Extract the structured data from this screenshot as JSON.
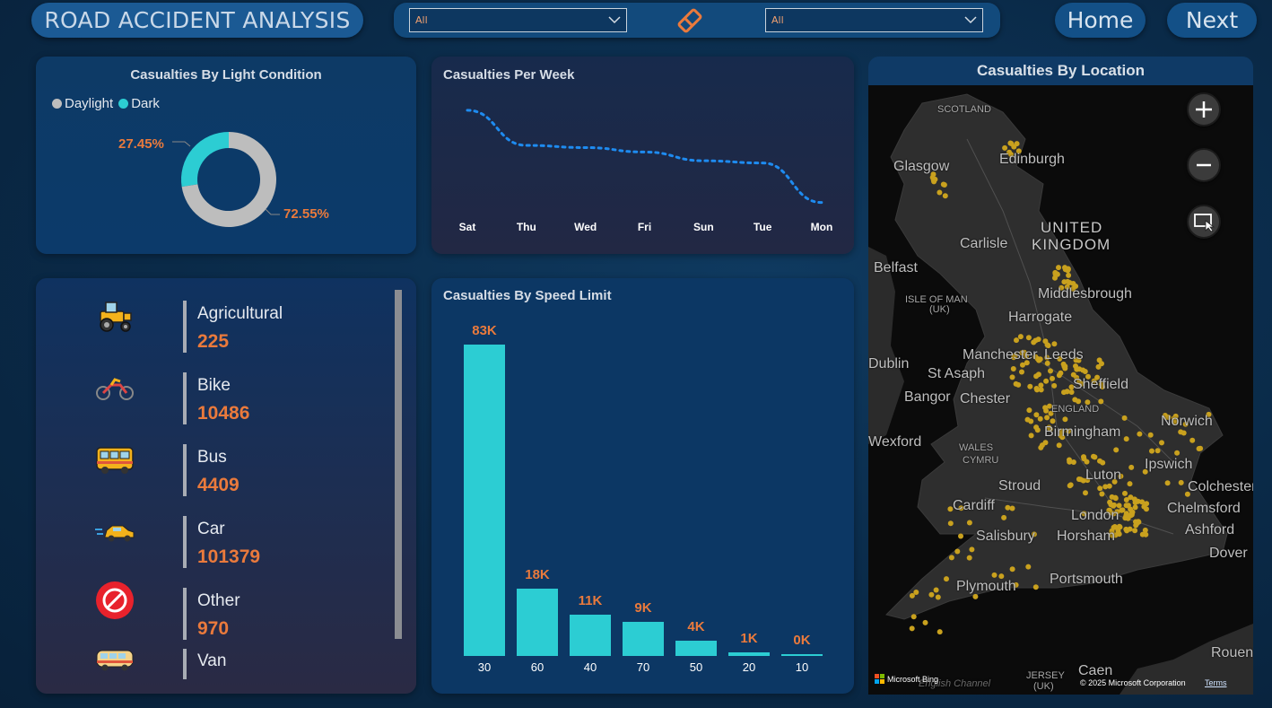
{
  "header": {
    "title": "ROAD ACCIDENT ANALYSIS",
    "filter_left": "All",
    "filter_right": "All",
    "home_label": "Home",
    "next_label": "Next",
    "eraser_icon": "eraser-icon"
  },
  "light_condition": {
    "title": "Casualties By Light Condition",
    "legend": [
      {
        "label": "Daylight",
        "color": "#bdbdbd"
      },
      {
        "label": "Dark",
        "color": "#2ccdd3"
      }
    ],
    "dark_pct": "27.45%",
    "daylight_pct": "72.55%",
    "chart_data": {
      "type": "pie",
      "categories": [
        "Daylight",
        "Dark"
      ],
      "values": [
        72.55,
        27.45
      ]
    }
  },
  "per_week": {
    "title": "Casualties Per Week",
    "chart_data": {
      "type": "line",
      "categories": [
        "Sat",
        "Thu",
        "Wed",
        "Fri",
        "Sun",
        "Tue",
        "Mon"
      ],
      "series": [
        {
          "values": [
            100,
            84,
            83,
            81,
            77,
            76,
            58
          ]
        }
      ],
      "ylim": [
        55,
        102
      ],
      "line_color": "#1e8bf0",
      "style": "dotted"
    }
  },
  "vehicles": {
    "items": [
      {
        "label": "Agricultural",
        "value": "225",
        "icon": "tractor-icon"
      },
      {
        "label": "Bike",
        "value": "10486",
        "icon": "motorbike-icon"
      },
      {
        "label": "Bus",
        "value": "4409",
        "icon": "bus-icon"
      },
      {
        "label": "Car",
        "value": "101379",
        "icon": "car-icon"
      },
      {
        "label": "Other",
        "value": "970",
        "icon": "prohibited-icon"
      },
      {
        "label": "Van",
        "value": "",
        "icon": "van-icon"
      }
    ]
  },
  "speed_limit": {
    "title": "Casualties By Speed Limit",
    "chart_data": {
      "type": "bar",
      "categories": [
        "30",
        "60",
        "40",
        "70",
        "50",
        "20",
        "10"
      ],
      "values": [
        83000,
        18000,
        11000,
        9000,
        4000,
        1000,
        0
      ],
      "data_labels": [
        "83K",
        "18K",
        "11K",
        "9K",
        "4K",
        "1K",
        "0K"
      ],
      "ylim": [
        0,
        83000
      ],
      "bar_color": "#2ccdd3"
    }
  },
  "map": {
    "title": "Casualties By Location",
    "zoom_in_icon": "plus-icon",
    "zoom_out_icon": "minus-icon",
    "select_icon": "select-area-icon",
    "places": [
      "SCOTLAND",
      "Edinburgh",
      "Glasgow",
      "UNITED",
      "KINGDOM",
      "Carlisle",
      "Belfast",
      "ISLE OF MAN",
      "(UK)",
      "Middlesbrough",
      "Harrogate",
      "Manchester",
      "Leeds",
      "Dublin",
      "St Asaph",
      "Sheffield",
      "Bangor",
      "Chester",
      "ENGLAND",
      "Norwich",
      "Birmingham",
      "Wexford",
      "WALES",
      "CYMRU",
      "Ipswich",
      "Colchester",
      "Luton",
      "Stroud",
      "Cardiff",
      "London",
      "Chelmsford",
      "Salisbury",
      "Horsham",
      "Ashford",
      "Dover",
      "Plymouth",
      "Portsmouth",
      "Rouen",
      "Caen",
      "JERSEY",
      "(UK)",
      "English Channel"
    ],
    "bing": "Microsoft Bing",
    "copyright": "© 2025 Microsoft Corporation",
    "terms": "Terms",
    "dot_color": "#c9a11e"
  }
}
